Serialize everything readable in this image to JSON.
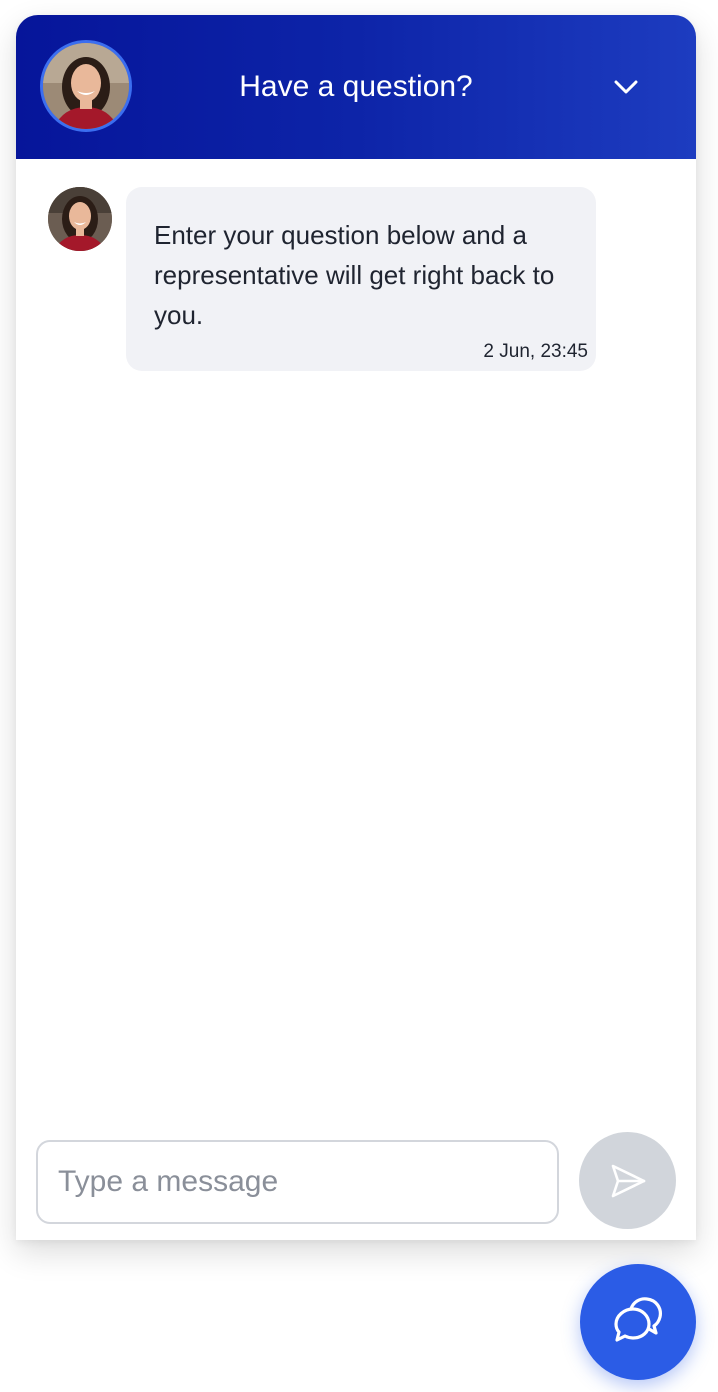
{
  "header": {
    "title": "Have a question?",
    "avatar_icon": "agent-avatar",
    "collapse_icon": "chevron-down-icon"
  },
  "messages": [
    {
      "sender": "agent",
      "text": "Enter your question below and a representative will get right back to you.",
      "time": "2 Jun, 23:45"
    }
  ],
  "composer": {
    "placeholder": "Type a message",
    "value": "",
    "send_icon": "send-icon"
  },
  "launcher": {
    "icon": "chat-bubbles-icon"
  },
  "colors": {
    "header_gradient_start": "#06159a",
    "header_gradient_end": "#1d3cc0",
    "accent": "#2b5ce6",
    "bubble_bg": "#f1f2f6",
    "send_disabled": "#d1d5db"
  }
}
